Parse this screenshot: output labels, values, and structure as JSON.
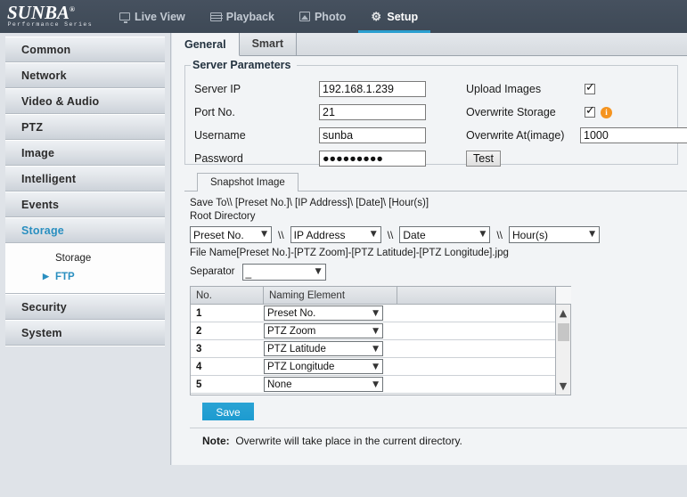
{
  "header": {
    "logo": {
      "brand": "SUNBA",
      "registered": "®",
      "tagline": "Performance Series"
    },
    "nav": [
      {
        "label": "Live View",
        "icon": "monitor-icon",
        "active": false
      },
      {
        "label": "Playback",
        "icon": "film-icon",
        "active": false
      },
      {
        "label": "Photo",
        "icon": "photo-icon",
        "active": false
      },
      {
        "label": "Setup",
        "icon": "gear-icon",
        "active": true
      }
    ],
    "accent_color": "#2a9fd0",
    "background_color": "#414c5a"
  },
  "sidebar": {
    "items": [
      {
        "label": "Common"
      },
      {
        "label": "Network"
      },
      {
        "label": "Video & Audio"
      },
      {
        "label": "PTZ"
      },
      {
        "label": "Image"
      },
      {
        "label": "Intelligent"
      },
      {
        "label": "Events"
      },
      {
        "label": "Storage",
        "active": true
      },
      {
        "label": "Security"
      },
      {
        "label": "System"
      }
    ],
    "submenu": [
      {
        "label": "Storage",
        "active": false
      },
      {
        "label": "FTP",
        "active": true,
        "marker": "▶"
      }
    ]
  },
  "content": {
    "tabs": [
      {
        "label": "General",
        "active": true
      },
      {
        "label": "Smart",
        "active": false
      }
    ],
    "server_parameters": {
      "legend": "Server Parameters",
      "fields": [
        {
          "label": "Server IP",
          "value": "192.168.1.239"
        },
        {
          "label": "Port No.",
          "value": "21"
        },
        {
          "label": "Username",
          "value": "sunba"
        },
        {
          "label": "Password",
          "value": "●●●●●●●●●"
        }
      ],
      "upload_images": {
        "label": "Upload Images",
        "checked": true
      },
      "overwrite_storage": {
        "label": "Overwrite Storage",
        "checked": true,
        "info": "i"
      },
      "overwrite_at": {
        "label": "Overwrite At(image)",
        "value": "1000"
      },
      "test_button": "Test"
    },
    "snapshot": {
      "tab_label": "Snapshot Image",
      "save_to_line": "Save To\\\\ [Preset No.]\\ [IP Address]\\ [Date]\\ [Hour(s)]",
      "root_directory_label": "Root Directory",
      "directory_selects": [
        {
          "value": "Preset No."
        },
        {
          "value": "IP Address"
        },
        {
          "value": "Date"
        },
        {
          "value": "Hour(s)"
        }
      ],
      "separator_glyph": "\\\\",
      "file_name_line": "File Name[Preset No.]-[PTZ Zoom]-[PTZ Latitude]-[PTZ Longitude].jpg",
      "separator_label": "Separator",
      "separator_value": "_",
      "table": {
        "columns": [
          "No.",
          "Naming Element",
          ""
        ],
        "rows": [
          {
            "no": "1",
            "element": "Preset No."
          },
          {
            "no": "2",
            "element": "PTZ Zoom"
          },
          {
            "no": "3",
            "element": "PTZ Latitude"
          },
          {
            "no": "4",
            "element": "PTZ Longitude"
          },
          {
            "no": "5",
            "element": "None"
          }
        ]
      }
    },
    "save_button": "Save",
    "note_label": "Note:",
    "note_text": "Overwrite will take place in the current directory."
  }
}
